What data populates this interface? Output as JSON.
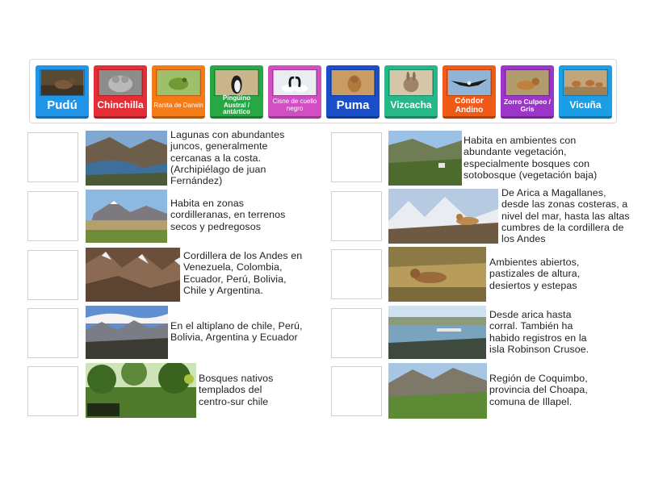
{
  "tiles": [
    {
      "label": "Pudú",
      "color": "#2196e8"
    },
    {
      "label": "Chinchilla",
      "color": "#e52d36"
    },
    {
      "label": "Ranita de Darwin",
      "color": "#f47b16"
    },
    {
      "label": "Pingüino Austral / antártico",
      "color": "#28a745"
    },
    {
      "label": "Cisne de cuello negro",
      "color": "#d14fc2"
    },
    {
      "label": "Puma",
      "color": "#1a4fc9"
    },
    {
      "label": "Vizcacha",
      "color": "#27b889"
    },
    {
      "label": "Cóndor Andino",
      "color": "#f15a16"
    },
    {
      "label": "Zorro Culpeo / Gris",
      "color": "#9b36c9"
    },
    {
      "label": "Vicuña",
      "color": "#1c9ee6"
    }
  ],
  "clues_left": [
    {
      "text": "Lagunas con abundantes juncos, generalmente cercanas a la costa. (Archipiélago de juan Fernández)"
    },
    {
      "text": "Habita en zonas cordilleranas, en terrenos secos y pedregosos"
    },
    {
      "text": "Cordillera de los Andes en Venezuela, Colombia, Ecuador, Perú, Bolivia, Chile y Argentina."
    },
    {
      "text": "En el altiplano de chile, Perú, Bolivia, Argentina y Ecuador"
    },
    {
      "text": "Bosques nativos templados del centro-sur chile"
    }
  ],
  "clues_right": [
    {
      "text": "Habita en ambientes con abundante vegetación, especialmente bosques con sotobosque (vegetación baja)"
    },
    {
      "text": "De Arica a Magallanes, desde las zonas costeras, a nivel del mar, hasta las altas cumbres de la cordillera de los Andes"
    },
    {
      "text": "Ambientes abiertos, pastizales de altura, desiertos y estepas"
    },
    {
      "text": "Desde arica hasta corral. También ha habido registros en la isla Robinson Crusoe."
    },
    {
      "text": "Región de Coquimbo, provincia del Choapa, comuna de Illapel."
    }
  ]
}
